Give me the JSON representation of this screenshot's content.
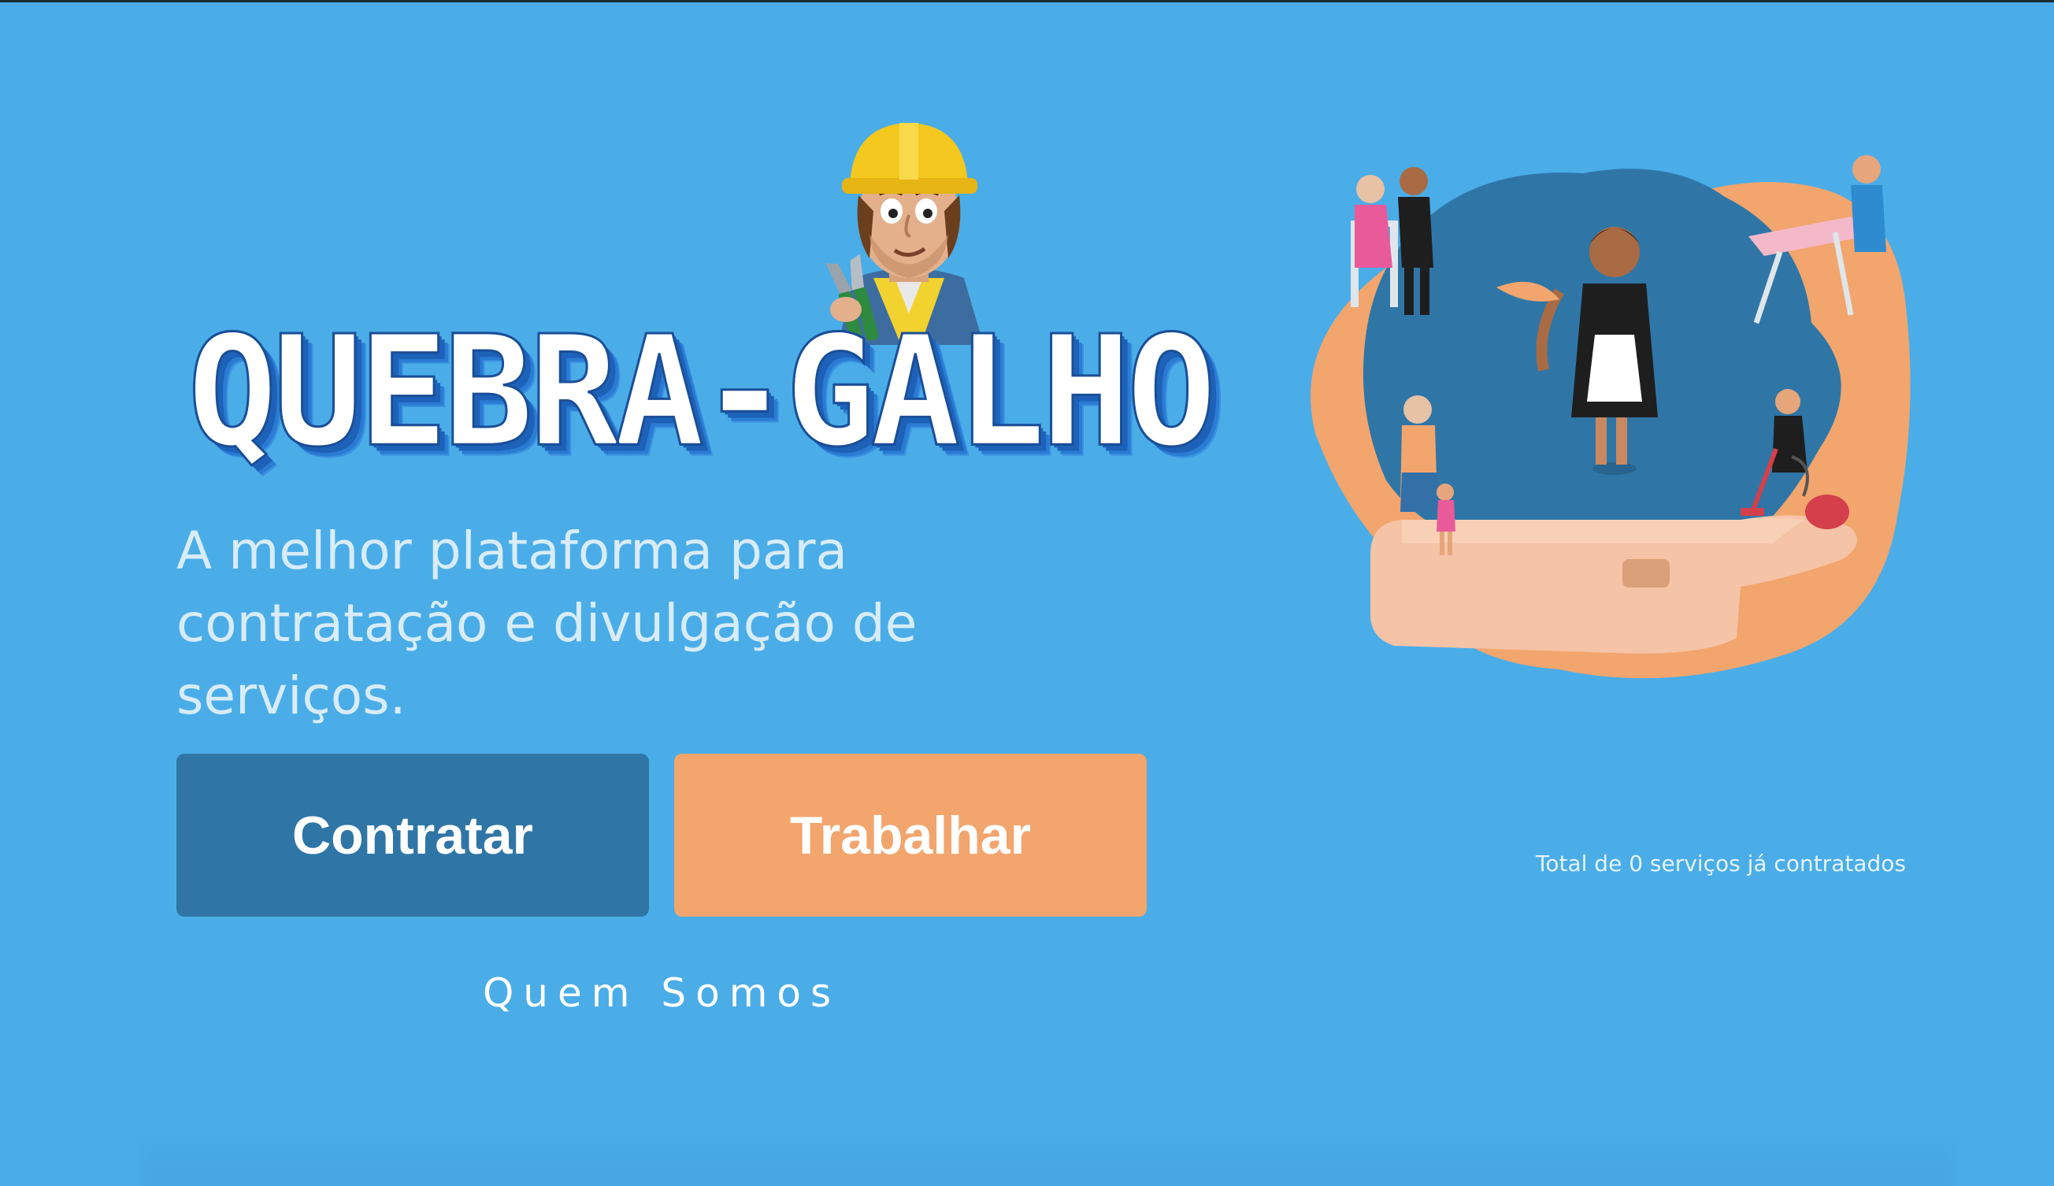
{
  "logo": {
    "text": "QUEBRA-GALHO",
    "icon": "construction-worker-mascot"
  },
  "hero": {
    "tagline": "A melhor plataforma para contratação e divulgação de serviços."
  },
  "actions": {
    "hire_label": "Contratar",
    "work_label": "Trabalhar",
    "about_label": "Quem Somos"
  },
  "stats": {
    "services_hired": "Total de 0 serviços já contratados"
  },
  "colors": {
    "background": "#4aade8",
    "hire_button": "#2f76a6",
    "work_button": "#f2a56d"
  },
  "illustration": {
    "icon": "hand-holding-service-workers-illustration"
  }
}
